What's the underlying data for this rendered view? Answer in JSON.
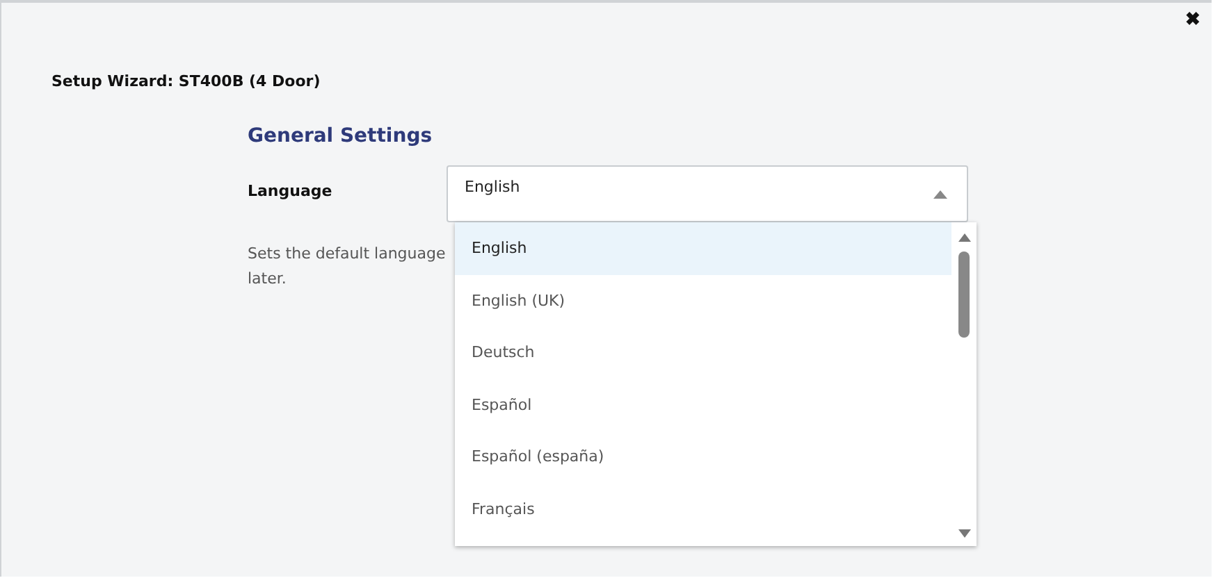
{
  "dialog": {
    "close": "✖",
    "title": "Setup Wizard: ST400B (4 Door)"
  },
  "section": {
    "heading": "General Settings"
  },
  "language": {
    "label": "Language",
    "value": "English",
    "expanded": true,
    "description_lines": [
      "Sets the default language",
      "later."
    ],
    "options": [
      {
        "label": "English",
        "selected": true
      },
      {
        "label": "English (UK)",
        "selected": false
      },
      {
        "label": "Deutsch",
        "selected": false
      },
      {
        "label": "Español",
        "selected": false
      },
      {
        "label": "Español (españa)",
        "selected": false
      },
      {
        "label": "Français",
        "selected": false
      }
    ]
  }
}
